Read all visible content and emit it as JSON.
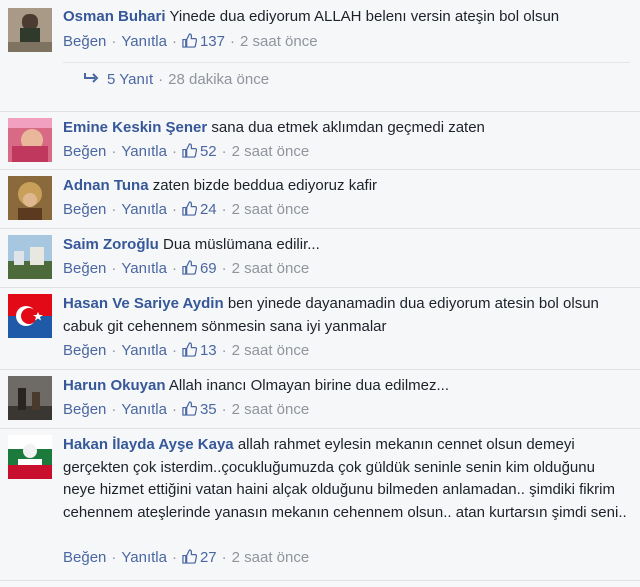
{
  "action_labels": {
    "like": "Beğen",
    "reply": "Yanıtla"
  },
  "comments": [
    {
      "author": "Osman Buhari",
      "text": "Yinede dua ediyorum ALLAH belenı versin ateşin bol olsun",
      "likes": "137",
      "time": "2 saat önce"
    },
    {
      "author": "Emine Keskin Şener",
      "text": "sana dua etmek aklımdan geçmedi zaten",
      "likes": "52",
      "time": "2 saat önce"
    },
    {
      "author": "Adnan Tuna",
      "text": "zaten bizde beddua ediyoruz kafir",
      "likes": "24",
      "time": "2 saat önce"
    },
    {
      "author": "Saim Zoroğlu",
      "text": "Dua müslümana edilir...",
      "likes": "69",
      "time": "2 saat önce"
    },
    {
      "author": "Hasan Ve Sariye Aydin",
      "text": "ben yinede dayanamadin dua ediyorum atesin bol olsun cabuk git cehennem sönmesin sana iyi yanmalar",
      "likes": "13",
      "time": "2 saat önce"
    },
    {
      "author": "Harun Okuyan",
      "text": "Allah inancı Olmayan birine dua edilmez...",
      "likes": "35",
      "time": "2 saat önce"
    },
    {
      "author": "Hakan İlayda Ayşe Kaya",
      "text": "allah rahmet eylesin mekanın cennet olsun demeyi gerçekten çok isterdim..çocukluğumuzda çok güldük seninle senin kim olduğunu neye hizmet ettiğini vatan haini alçak olduğunu bilmeden anlamadan.. şimdiki fikrim cehennem ateşlerinde yanasın mekanın cehennem olsun.. atan kurtarsın şimdi seni..",
      "likes": "27",
      "time": "2 saat önce"
    }
  ],
  "replies_summary": {
    "label": "5 Yanıt",
    "time": "28 dakika önce"
  }
}
